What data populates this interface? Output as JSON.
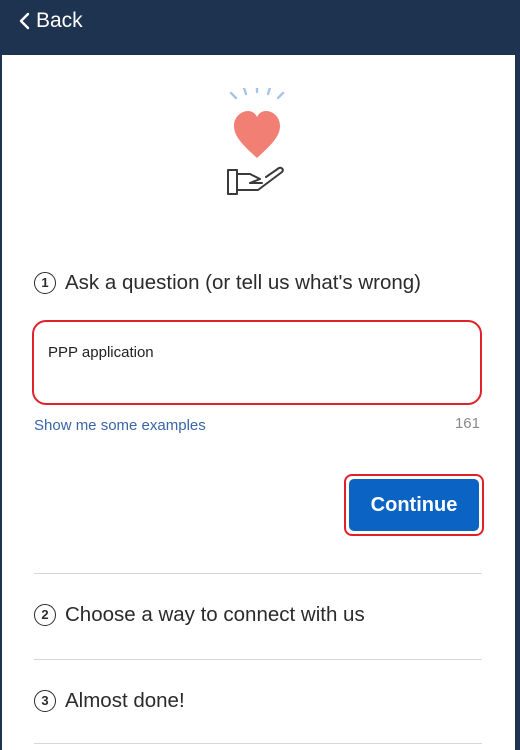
{
  "header": {
    "back_label": "Back",
    "background": "#1e3350"
  },
  "hero": {
    "icon": "heart-in-hand-icon",
    "heart_color": "#f17f73",
    "ray_color": "#a9c3e8"
  },
  "step1": {
    "number": "1",
    "label": "Ask a question (or tell us what's wrong)"
  },
  "question": {
    "value": "PPP application",
    "char_count": "161",
    "highlight_color": "#e0202a"
  },
  "examples_link": "Show me some examples",
  "continue_button": {
    "label": "Continue",
    "color": "#0b64c4"
  },
  "step2": {
    "number": "2",
    "label": "Choose a way to connect with us"
  },
  "step3": {
    "number": "3",
    "label": "Almost done!"
  }
}
